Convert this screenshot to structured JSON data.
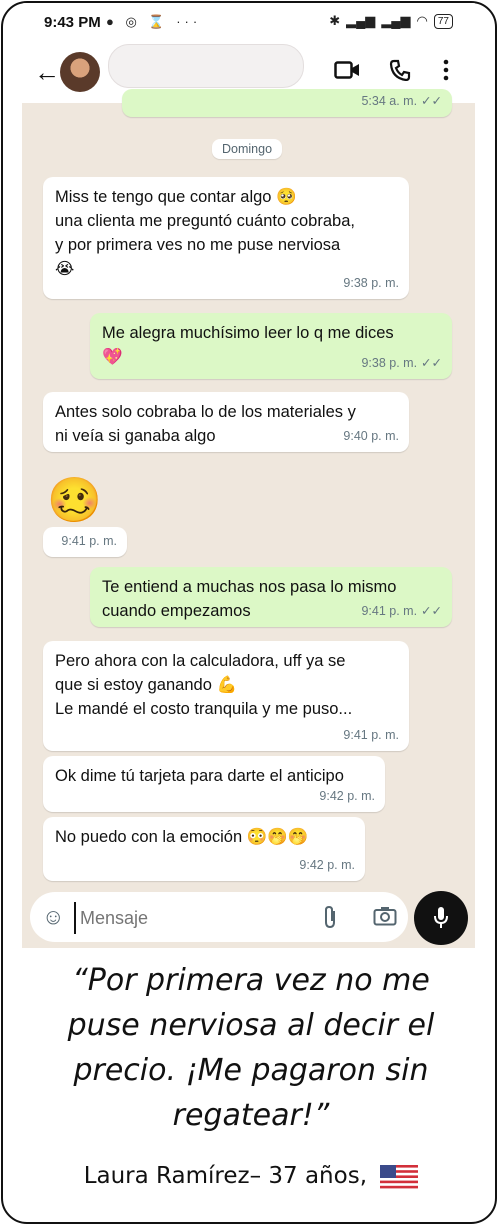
{
  "status_bar": {
    "time": "9:43 PM",
    "left_icons": "● ◎ ⌛ ···",
    "battery": "77"
  },
  "header": {
    "contact_name": ""
  },
  "chat": {
    "top_partial_time": "5:34 a. m.",
    "date_chip": "Domingo",
    "messages": [
      {
        "side": "in",
        "lines": [
          "Miss te tengo que contar algo 🥺",
          "una clienta me preguntó cuánto cobraba,",
          "y por primera ves no me puse nerviosa",
          "😭"
        ],
        "time": "9:38 p. m."
      },
      {
        "side": "out",
        "lines": [
          "Me alegra muchísimo leer lo q me dices",
          "💖"
        ],
        "time": "9:38 p. m."
      },
      {
        "side": "in",
        "lines": [
          "Antes solo cobraba lo de los materiales y",
          "ni veía si ganaba algo"
        ],
        "time": "9:40 p. m."
      },
      {
        "side": "in",
        "lines": [
          "🥴"
        ],
        "time": "9:41 p. m."
      },
      {
        "side": "out",
        "lines": [
          "Te entiend a muchas nos pasa lo mismo",
          "cuando empezamos"
        ],
        "time": "9:41 p. m."
      },
      {
        "side": "in",
        "lines": [
          "Pero ahora con la calculadora, uff ya se",
          "que si estoy ganando 💪",
          "Le mandé el costo tranquila y me puso..."
        ],
        "time": "9:41 p. m."
      },
      {
        "side": "in",
        "lines": [
          "Ok dime tú tarjeta para darte el anticipo"
        ],
        "time": "9:42 p. m."
      },
      {
        "side": "in",
        "lines": [
          "No puedo con la emoción 😳🤭🤭"
        ],
        "time": "9:42 p. m."
      }
    ]
  },
  "input": {
    "placeholder": "Mensaje"
  },
  "testimonial": {
    "quote": "“Por primera vez no me puse nerviosa al decir el precio. ¡Me pagaron sin regatear!”",
    "author": "Laura Ramírez– 37 años,"
  }
}
